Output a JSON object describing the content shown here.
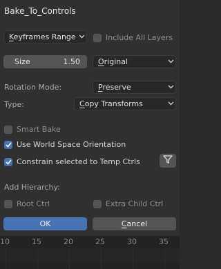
{
  "dialog": {
    "title": "Bake_To_Controls",
    "range_mode": {
      "selected": "Keyframes Range",
      "accel": "K",
      "rest": "eyframes Range"
    },
    "include_all_layers": {
      "label": "Include All Layers",
      "checked": false
    },
    "size": {
      "label": "Size",
      "value": "1.50"
    },
    "size_mode": {
      "selected": "Original",
      "accel": "O",
      "rest": "riginal"
    },
    "rotation_mode": {
      "label": "Rotation Mode:",
      "selected": "Preserve",
      "accel": "P",
      "rest": "reserve"
    },
    "type": {
      "label": "Type:",
      "selected": "Copy Transforms",
      "accel": "C",
      "rest": "opy Transforms"
    },
    "smart_bake": {
      "label": "Smart Bake",
      "checked": false
    },
    "use_world_space": {
      "label": "Use World Space Orientation",
      "checked": true
    },
    "constrain_selected": {
      "label": "Constrain selected to Temp Ctrls",
      "checked": true
    },
    "add_hierarchy": {
      "label": "Add Hierarchy:"
    },
    "root_ctrl": {
      "label": "Root Ctrl",
      "checked": false
    },
    "extra_child_ctrl": {
      "label": "Extra Child Ctrl",
      "checked": false
    },
    "ok_label": "OK",
    "cancel": {
      "label": "Cancel",
      "accel": "C",
      "rest": "ancel"
    }
  },
  "timeline": {
    "frames": [
      "10",
      "15",
      "20",
      "25",
      "30",
      "35"
    ]
  },
  "colors": {
    "accent": "#4772b3",
    "panel_bg": "#303030",
    "field_bg": "#282828",
    "button_bg": "#545454"
  }
}
